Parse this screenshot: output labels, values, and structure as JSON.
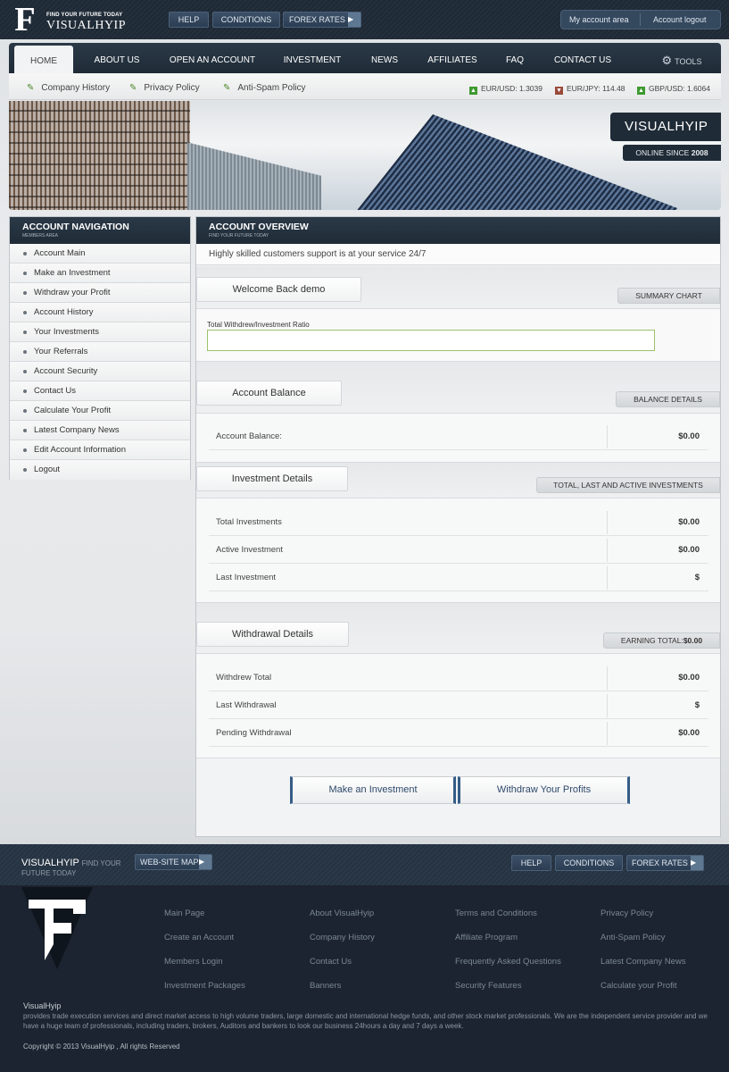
{
  "brand": {
    "tagline": "FIND YOUR FUTURE TODAY",
    "name": "VISUALHYIP",
    "logo_letter": "F"
  },
  "topbar": {
    "links": [
      "HELP",
      "CONDITIONS",
      "FOREX RATES"
    ],
    "account_area": "My account area",
    "logout": "Account logout"
  },
  "nav": {
    "items": [
      "HOME",
      "ABOUT US",
      "OPEN AN ACCOUNT",
      "INVESTMENT",
      "NEWS",
      "AFFILIATES",
      "FAQ",
      "CONTACT US"
    ],
    "tools": "TOOLS"
  },
  "subnav": {
    "links": [
      "Company History",
      "Privacy Policy",
      "Anti-Spam Policy"
    ],
    "rates": [
      "EUR/USD: 1.3039",
      "EUR/JPY: 114.48",
      "GBP/USD: 1.6064"
    ]
  },
  "banner": {
    "title": "VISUALHYIP",
    "since_label": "ONLINE SINCE",
    "since_year": "2008"
  },
  "sidebar": {
    "title": "ACCOUNT NAVIGATION",
    "subtitle": "MEMBERS AREA",
    "items": [
      "Account Main",
      "Make an Investment",
      "Withdraw your Profit",
      "Account History",
      "Your Investments",
      "Your Referrals",
      "Account Security",
      "Contact Us",
      "Calculate Your Profit",
      "Latest Company News",
      "Edit Account Information",
      "Logout"
    ]
  },
  "main": {
    "title": "ACCOUNT OVERVIEW",
    "subtitle": "FIND YOUR FUTURE TODAY",
    "support": "Highly skilled customers support is at your service 24/7",
    "welcome": {
      "tab": "Welcome Back demo",
      "label": "SUMMARY CHART",
      "ratio_label": "Total Withdrew/Investment Ratio"
    },
    "balance": {
      "tab": "Account Balance",
      "label": "BALANCE DETAILS",
      "rows": [
        {
          "label": "Account Balance:",
          "value": "$0.00"
        }
      ]
    },
    "investment": {
      "tab": "Investment Details",
      "label": "TOTAL, LAST AND ACTIVE INVESTMENTS",
      "rows": [
        {
          "label": "Total Investments",
          "value": "$0.00"
        },
        {
          "label": "Active Investment",
          "value": "$0.00"
        },
        {
          "label": "Last Investment",
          "value": "$"
        }
      ]
    },
    "withdrawal": {
      "tab": "Withdrawal Details",
      "label": "EARNING TOTAL:",
      "label_value": "$0.00",
      "rows": [
        {
          "label": "Withdrew Total",
          "value": "$0.00"
        },
        {
          "label": "Last Withdrawal",
          "value": "$"
        },
        {
          "label": "Pending Withdrawal",
          "value": "$0.00"
        }
      ]
    },
    "buttons": {
      "invest": "Make an Investment",
      "withdraw": "Withdraw Your Profits"
    }
  },
  "footer_bar": {
    "name": "VISUALHYIP",
    "tag1": "FIND YOUR",
    "tag2": "FUTURE TODAY",
    "sitemap": "WEB-SITE MAP",
    "links": [
      "HELP",
      "CONDITIONS",
      "FOREX RATES"
    ]
  },
  "footer": {
    "columns": [
      [
        "Main Page",
        "Create an Account",
        "Members Login",
        "Investment Packages"
      ],
      [
        "About VisualHyip",
        "Company History",
        "Contact Us",
        "Banners"
      ],
      [
        "Terms and Conditions",
        "Affiliate Program",
        "Frequently Asked Questions",
        "Security Features"
      ],
      [
        "Privacy Policy",
        "Anti-Spam Policy",
        "Latest Company News",
        "Calculate your Profit"
      ]
    ],
    "about_title": "VisualHyip",
    "about": "provides trade execution services and direct market access to high volume traders, large domestic and international hedge funds, and other stock market professionals. We are the independent service provider and we have a huge team of professionals, including traders, brokers, Auditors and bankers to look our business 24hours a day and 7 days a week.",
    "copyright": "Copyright © 2013 VisualHyip , All rights Reserved"
  },
  "colors": {
    "accent": "#345d86",
    "dark": "#1f2b37",
    "rate_up": "#3d9a2f",
    "rate_down": "#9b4a3a"
  }
}
